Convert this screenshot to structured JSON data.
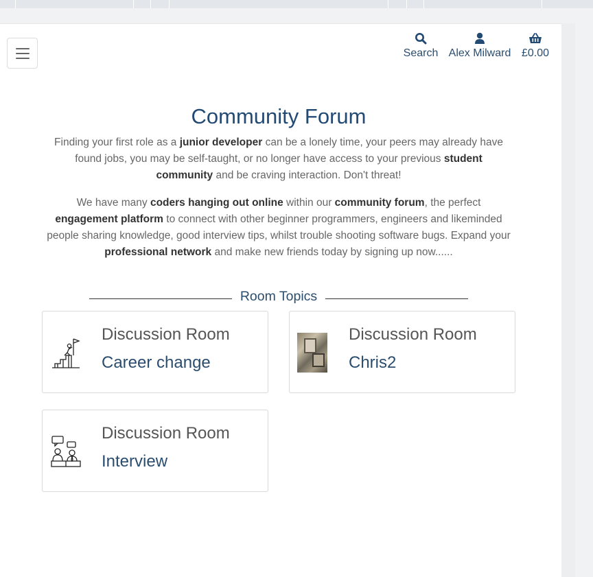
{
  "header": {
    "search_label": "Search",
    "user_label": "Alex Milward",
    "cart_label": "£0.00"
  },
  "main": {
    "title": "Community Forum",
    "intro_1": {
      "t1": "Finding your first role as a ",
      "b1": "junior developer",
      "t2": " can be a lonely time, your peers may already have found jobs, you may be self-taught, or no longer have access to your previous ",
      "b2": "student community",
      "t3": " and be craving interaction. Don't threat!"
    },
    "intro_2": {
      "t1": "We have many ",
      "b1": "coders hanging out online",
      "t2": " within our ",
      "b2": "community forum",
      "t3": ", the perfect ",
      "b3": "engagement platform",
      "t4": " to connect with other beginner programmers, engineers and likeminded people sharing knowledge, good interview tips, whilst trouble shooting software bugs. Expand your ",
      "b4": "professional network",
      "t5": " and make new friends today by signing up now......"
    },
    "section_heading": "Room Topics",
    "rooms": [
      {
        "title": "Discussion Room",
        "name": "Career change",
        "icon": "career-ladder-icon"
      },
      {
        "title": "Discussion Room",
        "name": "Chris2",
        "icon": "photo-thumbnail"
      },
      {
        "title": "Discussion Room",
        "name": "Interview",
        "icon": "interview-icon"
      }
    ]
  },
  "colors": {
    "accent": "#234a73",
    "text": "#666666",
    "border": "#d9d9d9"
  }
}
